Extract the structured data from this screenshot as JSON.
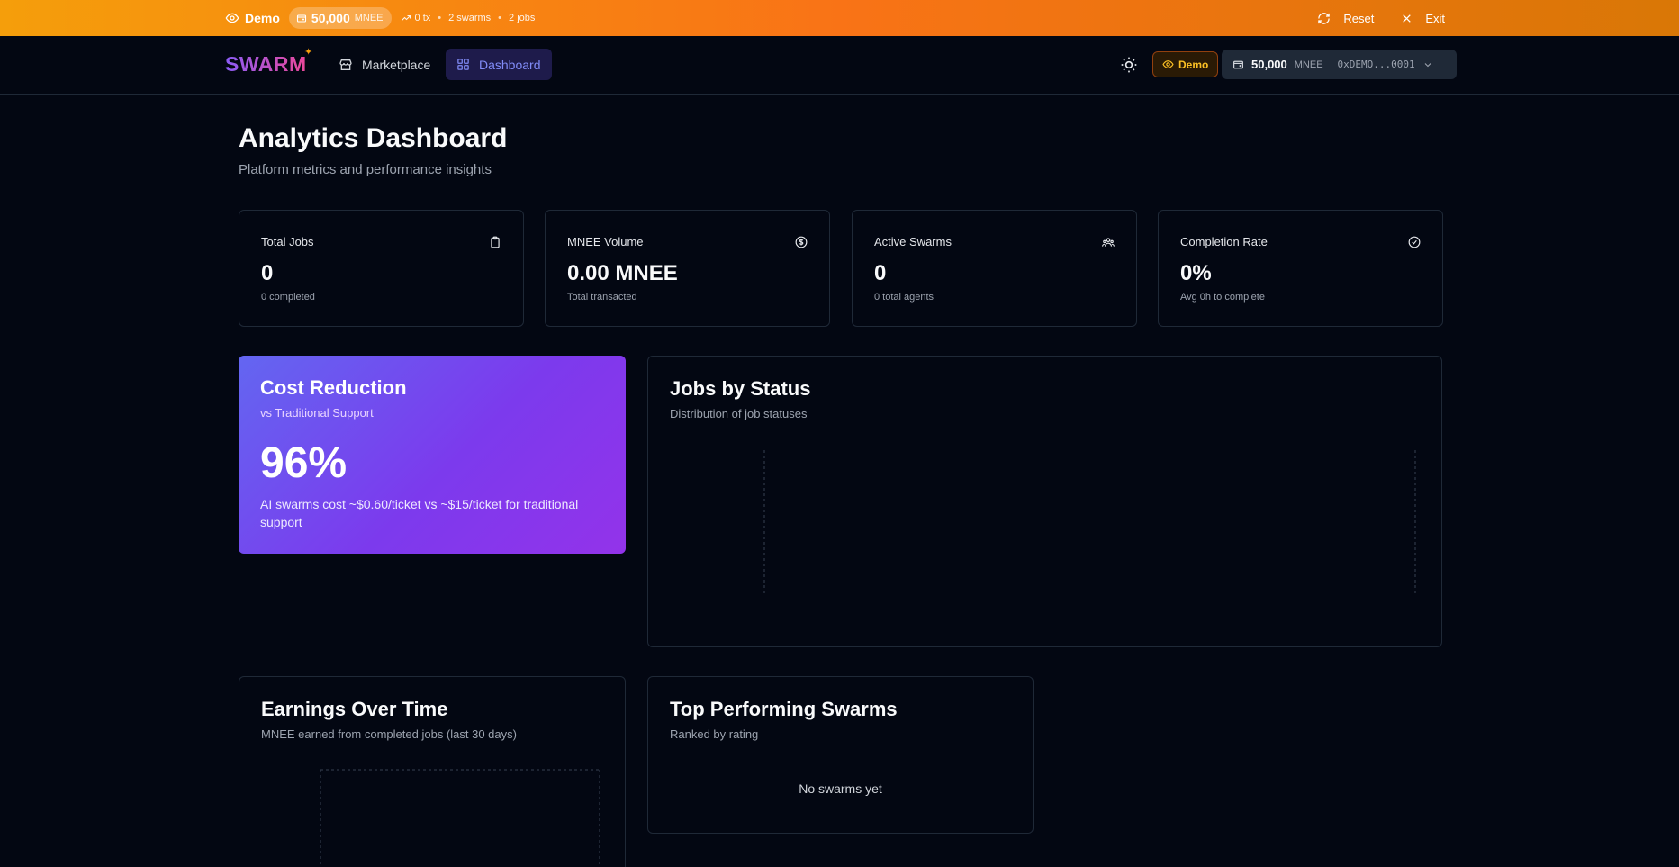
{
  "banner": {
    "mode_label": "Demo",
    "balance": "50,000",
    "balance_unit": "MNEE",
    "tx": "0 tx",
    "swarms": "2 swarms",
    "jobs": "2 jobs",
    "sep": "•",
    "reset_label": "Reset",
    "exit_label": "Exit",
    "colors": {
      "start": "#f59e0b",
      "mid": "#f97316",
      "end": "#d97706"
    }
  },
  "nav": {
    "logo": "SWARM",
    "marketplace_label": "Marketplace",
    "dashboard_label": "Dashboard",
    "demo_badge": "Demo",
    "wallet_balance": "50,000",
    "wallet_unit": "MNEE",
    "wallet_address": "0xDEMO...0001"
  },
  "header": {
    "title": "Analytics Dashboard",
    "subtitle": "Platform metrics and performance insights"
  },
  "stats": [
    {
      "label": "Total Jobs",
      "value": "0",
      "hint": "0 completed",
      "icon": "clipboard-icon"
    },
    {
      "label": "MNEE Volume",
      "value": "0.00 MNEE",
      "hint": "Total transacted",
      "icon": "dollar-circle-icon"
    },
    {
      "label": "Active Swarms",
      "value": "0",
      "hint": "0 total agents",
      "icon": "users-icon"
    },
    {
      "label": "Completion Rate",
      "value": "0%",
      "hint": "Avg 0h to complete",
      "icon": "check-circle-icon"
    }
  ],
  "cost_reduction": {
    "title": "Cost Reduction",
    "subtitle": "vs Traditional Support",
    "value": "96%",
    "description": "AI swarms cost ~$0.60/ticket vs ~$15/ticket for traditional support"
  },
  "jobs_by_status": {
    "title": "Jobs by Status",
    "subtitle": "Distribution of job statuses"
  },
  "earnings": {
    "title": "Earnings Over Time",
    "subtitle": "MNEE earned from completed jobs (last 30 days)"
  },
  "top_swarms": {
    "title": "Top Performing Swarms",
    "subtitle": "Ranked by rating",
    "empty": "No swarms yet"
  },
  "colors": {
    "background": "#030712",
    "border": "#1f2937",
    "accent": "#818cf8",
    "demo_amber": "#fbbf24"
  }
}
